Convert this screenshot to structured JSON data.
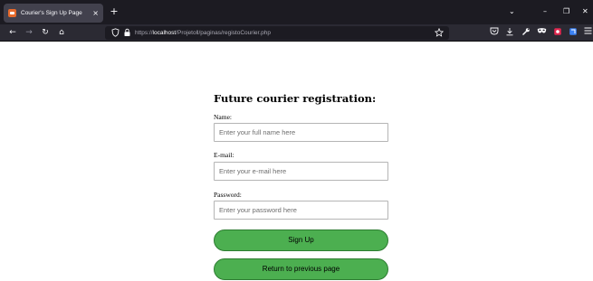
{
  "browser": {
    "tab_title": "Courier's Sign Up Page",
    "tab_close": "×",
    "new_tab": "+",
    "url_scheme": "https://",
    "url_host": "localhost",
    "url_path": "/Projetoll/paginas/registoCourier.php",
    "window_controls": {
      "list_tabs": "⌄",
      "minimize": "–",
      "restore": "❐",
      "close": "✕"
    },
    "nav": {
      "back": "←",
      "forward": "→",
      "reload": "↻",
      "home": "⌂"
    },
    "icons": {
      "tracking_protection": "shield-icon",
      "lock": "lock-icon",
      "bookmark": "star-icon",
      "pocket": "pocket-icon",
      "downloads": "download-icon",
      "devtools": "wrench-icon",
      "private": "mask-icon",
      "extension": "extension-icon",
      "menu": "hamburger-icon"
    }
  },
  "form": {
    "heading": "Future courier registration:",
    "name_label": "Name:",
    "name_placeholder": "Enter your full name here",
    "email_label": "E-mail:",
    "email_placeholder": "Enter your e-mail here",
    "password_label": "Password:",
    "password_placeholder": "Enter your password here",
    "signup_label": "Sign Up",
    "return_label": "Return to previous page"
  },
  "colors": {
    "button_green": "#4caf50",
    "button_border": "#2e7d32",
    "chrome_dark": "#1c1b22",
    "chrome_toolbar": "#2b2a33"
  }
}
